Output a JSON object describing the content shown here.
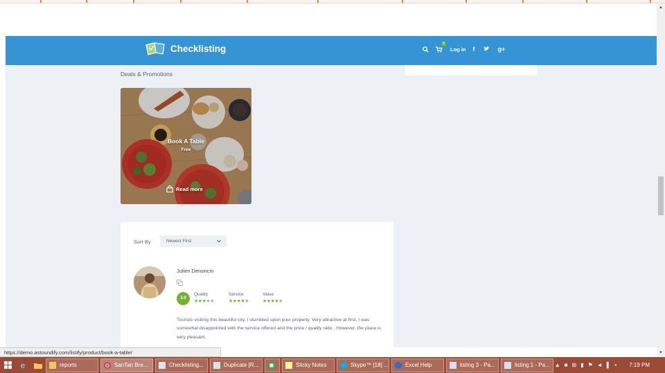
{
  "header": {
    "logo_text": "Checklisting",
    "login_label": "Log in",
    "cart_count": "0",
    "social": [
      "f",
      "t",
      "g+"
    ]
  },
  "deals": {
    "section_title": "Deals & Promotions",
    "card_title": "Book A Table",
    "card_price": "Free",
    "read_more": "Read more"
  },
  "reviews": {
    "sort_label": "Sort By",
    "sort_value": "Newest First",
    "reviewer": "Julien Denoncin",
    "score": "3.0",
    "ratings": [
      {
        "label": "Quality",
        "stars": 3
      },
      {
        "label": "Service",
        "stars": 4
      },
      {
        "label": "Value",
        "stars": 4
      }
    ],
    "text": "Tourists visiting this beautiful city, I stumbled upon your property. Very attractive at first, I was somewhat disappointed with the service offered and the price / quality ratio . However, the place is very pleasant."
  },
  "status_url": "https://demo.astoundify.com/listify/product/book-a-table/",
  "taskbar": {
    "buttons": [
      "reports",
      "SanTan Bre...",
      "Checklisting...",
      "Duplicate [R...",
      "",
      "Sticky Notes",
      "Skype™ [18] ...",
      "Excel Help",
      "listing 3 - Pa...",
      "listing 1 - Pa..."
    ],
    "clock": "7:19 PM"
  },
  "colors": {
    "brand_blue": "#3594d3",
    "accent_green": "#73b330",
    "taskbar": "#9a4a35"
  }
}
